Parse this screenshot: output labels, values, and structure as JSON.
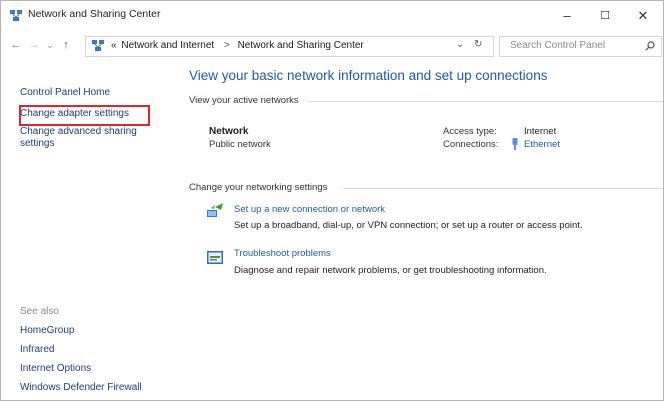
{
  "window": {
    "title": "Network and Sharing Center",
    "minimize": "–",
    "maximize": "☐",
    "close": "✕"
  },
  "address": {
    "back": "←",
    "forward": "→",
    "dropdown": "⌄",
    "up": "↑",
    "crumbs": [
      "«",
      "Network and Internet",
      ">",
      "Network and Sharing Center"
    ],
    "refresh": "↻",
    "search_placeholder": "Search Control Panel"
  },
  "sidebar": {
    "home": "Control Panel Home",
    "items": [
      "Change adapter settings",
      "Change advanced sharing",
      "settings"
    ],
    "see_also_heading": "See also",
    "see_also": [
      "HomeGroup",
      "Infrared",
      "Internet Options",
      "Windows Defender Firewall"
    ]
  },
  "main": {
    "heading": "View your basic network information and set up connections",
    "active_networks_heading": "View your active networks",
    "network": {
      "name": "Network",
      "type": "Public network",
      "access_type_label": "Access type:",
      "access_type_value": "Internet",
      "connections_label": "Connections:",
      "connections_value": "Ethernet"
    },
    "change_settings_heading": "Change your networking settings",
    "tasks": [
      {
        "title": "Set up a new connection or network",
        "description": "Set up a broadband, dial-up, or VPN connection; or set up a router or access point."
      },
      {
        "title": "Troubleshoot problems",
        "description": "Diagnose and repair network problems, or get troubleshooting information."
      }
    ]
  },
  "colors": {
    "link": "#1e5aa8",
    "highlight": "#e0262b"
  }
}
